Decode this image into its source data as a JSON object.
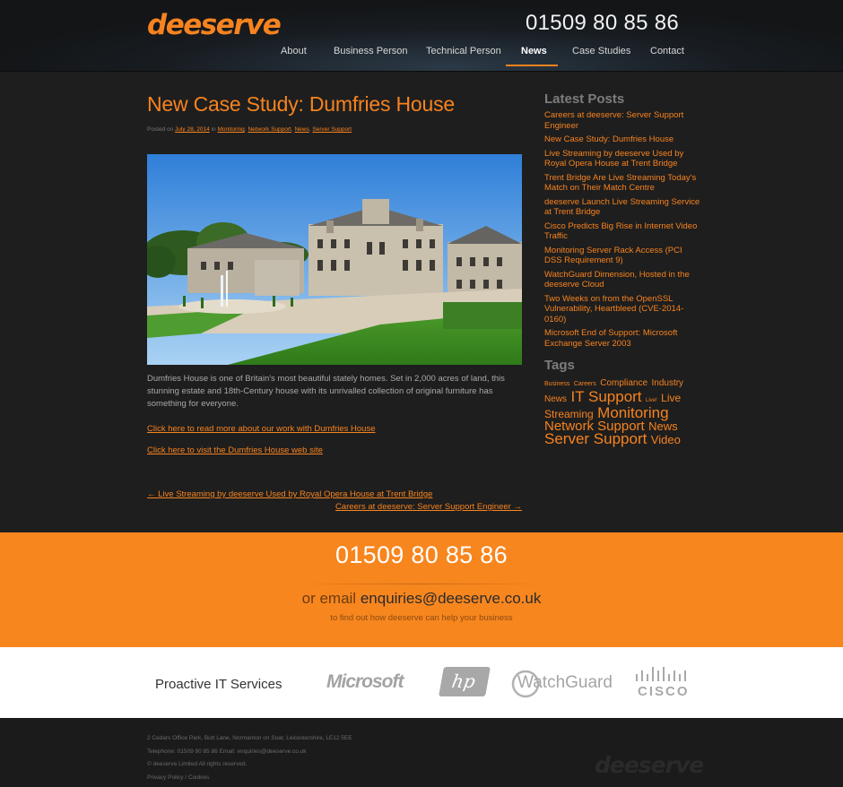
{
  "header": {
    "logo": "deeserve",
    "phone": "01509 80 85 86",
    "nav": [
      "About",
      "Business Person",
      "Technical Person",
      "News",
      "Case Studies",
      "Contact"
    ],
    "active_nav": "News"
  },
  "post": {
    "title": "New Case Study: Dumfries House",
    "meta_prefix": "Posted on",
    "date": "July 28, 2014",
    "meta_in": "in",
    "categories": [
      "Monitoring",
      "Network Support",
      "News",
      "Server Support"
    ],
    "body": "Dumfries House is one of Britain's most beautiful stately homes. Set in 2,000 acres of land, this stunning estate and 18th-Century house with its unrivalled collection of original furniture has something for everyone.",
    "link1": "Click here to read more about our work with Dumfries House",
    "link2": "Click here to visit the Dumfries House web site",
    "prev": "← Live Streaming by deeserve Used by Royal Opera House at Trent Bridge",
    "next": "Careers at deeserve: Server Support Engineer →"
  },
  "sidebar": {
    "latest_heading": "Latest Posts",
    "latest_posts": [
      "Careers at deeserve: Server Support Engineer",
      "New Case Study: Dumfries House",
      "Live Streaming by deeserve Used by Royal Opera House at Trent Bridge",
      "Trent Bridge Are Live Streaming Today's Match on Their Match Centre",
      "deeserve Launch Live Streaming Service at Trent Bridge",
      "Cisco Predicts Big Rise in Internet Video Traffic",
      "Monitoring Server Rack Access (PCI DSS Requirement 9)",
      "WatchGuard Dimension, Hosted in the deeserve Cloud",
      "Two Weeks on from the OpenSSL Vulnerability, Heartbleed (CVE-2014-0160)",
      "Microsoft End of Support: Microsoft Exchange Server 2003"
    ],
    "tags_heading": "Tags",
    "tags": [
      {
        "label": "Business",
        "size": 7
      },
      {
        "label": "Careers",
        "size": 7
      },
      {
        "label": "Compliance",
        "size": 10
      },
      {
        "label": "Industry",
        "size": 10
      },
      {
        "label": "News",
        "size": 10
      },
      {
        "label": "IT Support",
        "size": 17
      },
      {
        "label": "Live!",
        "size": 6
      },
      {
        "label": "Live Streaming",
        "size": 12
      },
      {
        "label": "Monitoring",
        "size": 17
      },
      {
        "label": "Network Support",
        "size": 15
      },
      {
        "label": "News",
        "size": 13
      },
      {
        "label": "Server Support",
        "size": 17
      },
      {
        "label": "Video",
        "size": 13
      }
    ]
  },
  "band": {
    "phone": "01509 80 85 86",
    "email_prefix": "or email",
    "email": "enquiries@deeserve.co.uk",
    "sub": "to find out how deeserve can help your business"
  },
  "partners": {
    "title": "Proactive IT Services",
    "logos": [
      "Microsoft",
      "hp",
      "WatchGuard",
      "CISCO"
    ]
  },
  "footer": {
    "address": "2 Cedars Office Park, Butt Lane, Normanton on Soar, Leicestershire, LE12 5EE",
    "contact": "Telephone: 01509 80 85 86 Email: enquiries@deeserve.co.uk",
    "copyright": "© deeserve Limited All rights reserved.",
    "policy": "Privacy Policy / Cookies",
    "logo": "deeserve"
  }
}
